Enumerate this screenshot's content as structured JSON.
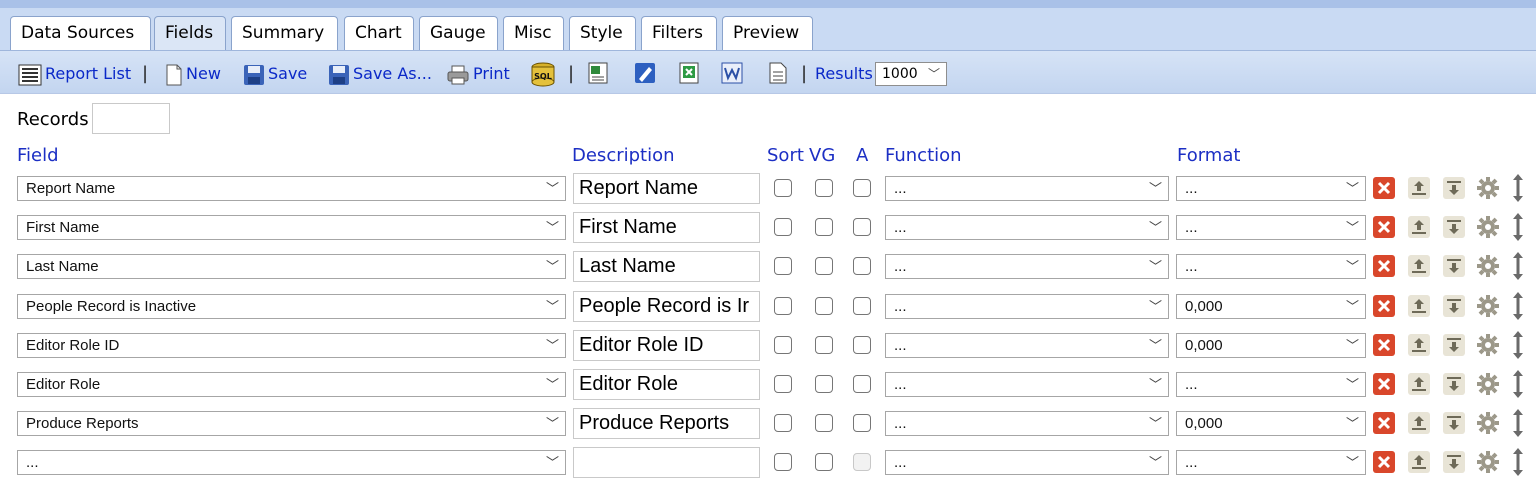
{
  "tabs": [
    {
      "label": "Data Sources",
      "active": false
    },
    {
      "label": "Fields",
      "active": true
    },
    {
      "label": "Summary",
      "active": false
    },
    {
      "label": "Chart",
      "active": false
    },
    {
      "label": "Gauge",
      "active": false
    },
    {
      "label": "Misc",
      "active": false
    },
    {
      "label": "Style",
      "active": false
    },
    {
      "label": "Filters",
      "active": false
    },
    {
      "label": "Preview",
      "active": false
    }
  ],
  "toolbar": {
    "report_list": "Report List",
    "new": "New",
    "save": "Save",
    "save_as": "Save As...",
    "print": "Print",
    "sql": "SQL",
    "results_label": "Results",
    "results_value": "1000",
    "separator": "|"
  },
  "records": {
    "label": "Records",
    "value": ""
  },
  "headers": {
    "field": "Field",
    "description": "Description",
    "sort": "Sort",
    "vg": "VG",
    "a": "A",
    "function": "Function",
    "format": "Format"
  },
  "rows": [
    {
      "field": "Report Name",
      "description": "Report Name",
      "function": "...",
      "format": "...",
      "sort": false,
      "vg": false,
      "a": false,
      "a_disabled": false
    },
    {
      "field": "First Name",
      "description": "First Name",
      "function": "...",
      "format": "...",
      "sort": false,
      "vg": false,
      "a": false,
      "a_disabled": false
    },
    {
      "field": "Last Name",
      "description": "Last Name",
      "function": "...",
      "format": "...",
      "sort": false,
      "vg": false,
      "a": false,
      "a_disabled": false
    },
    {
      "field": "People Record is Inactive",
      "description": "People Record is Ir",
      "function": "...",
      "format": "0,000",
      "sort": false,
      "vg": false,
      "a": false,
      "a_disabled": false
    },
    {
      "field": "Editor Role ID",
      "description": "Editor Role ID",
      "function": "...",
      "format": "0,000",
      "sort": false,
      "vg": false,
      "a": false,
      "a_disabled": false
    },
    {
      "field": "Editor Role",
      "description": "Editor Role",
      "function": "...",
      "format": "...",
      "sort": false,
      "vg": false,
      "a": false,
      "a_disabled": false
    },
    {
      "field": "Produce Reports",
      "description": "Produce Reports",
      "function": "...",
      "format": "0,000",
      "sort": false,
      "vg": false,
      "a": false,
      "a_disabled": false
    },
    {
      "field": "...",
      "description": "",
      "function": "...",
      "format": "...",
      "sort": false,
      "vg": false,
      "a": false,
      "a_disabled": true
    }
  ],
  "row_actions": [
    "delete-icon",
    "move-up-icon",
    "move-down-icon",
    "settings-gear-icon",
    "drag-reorder-icon"
  ],
  "colors": {
    "tab_bar": "#c9daf3",
    "toolbar": "#c3d5f0",
    "link_blue": "#0a28c8",
    "header_blue": "#1c2fc4",
    "delete_red": "#d9472b"
  }
}
